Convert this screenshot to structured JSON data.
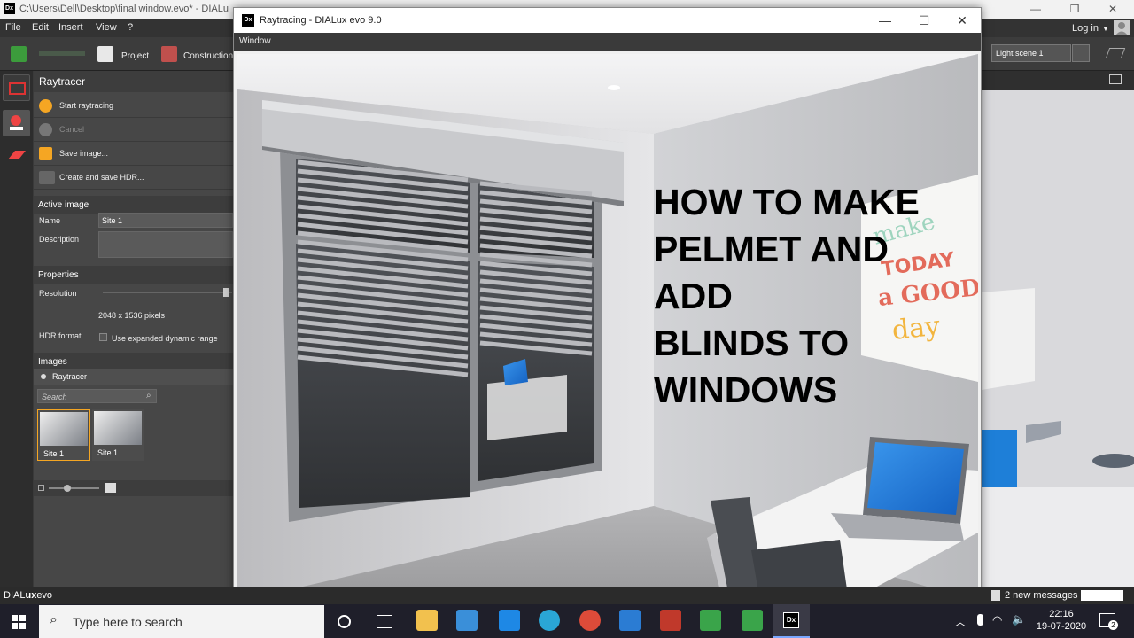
{
  "app_title": {
    "path": "C:\\Users\\Dell\\Desktop\\final window.evo* - DIALu",
    "logo": "Dx"
  },
  "menu": {
    "items": [
      "File",
      "Edit",
      "Insert",
      "View",
      "?"
    ],
    "login": "Log in"
  },
  "toolbar": {
    "project_label": "Project",
    "construction_label": "Construction",
    "scene_select": "Light scene 1"
  },
  "panel": {
    "title": "Raytracer",
    "actions": [
      {
        "label": "Start raytracing",
        "icon": "play-icon"
      },
      {
        "label": "Cancel",
        "icon": "cancel-icon"
      },
      {
        "label": "Save image...",
        "icon": "save-image-icon"
      },
      {
        "label": "Create and save HDR...",
        "icon": "hdr-icon"
      }
    ],
    "active_image": {
      "heading": "Active image",
      "name_label": "Name",
      "name_value": "Site 1",
      "description_label": "Description"
    },
    "properties": {
      "heading": "Properties",
      "resolution_label": "Resolution",
      "resolution_value": "2048 x 1536 pixels",
      "resolution_fraction": 0.97,
      "hdr_label": "HDR format",
      "hdr_option": "Use expanded dynamic range"
    },
    "images": {
      "heading": "Images",
      "source": "Raytracer",
      "search_placeholder": "Search",
      "thumbs": [
        "Site 1",
        "Site 1"
      ],
      "zoom_fraction": 0.35
    }
  },
  "raytracing_window": {
    "logo": "Dx",
    "title": "Raytracing - DIALux evo 9.0",
    "menu": "Window",
    "minimize": "—",
    "maximize": "☐",
    "close": "✕"
  },
  "headline": [
    "HOW TO MAKE",
    "PELMET AND",
    "ADD",
    "BLINDS TO",
    "WINDOWS"
  ],
  "status": {
    "brand_dial": "DIAL",
    "brand_ux": "ux",
    "brand_evo": "evo",
    "messages": "2 new messages"
  },
  "taskbar": {
    "search_placeholder": "Type here to search",
    "time": "22:16",
    "date": "19-07-2020",
    "notifications": "2"
  },
  "colors": {
    "accent": "#f5a623",
    "panel": "#474747",
    "laptop_screen": "#1e7fd8"
  }
}
